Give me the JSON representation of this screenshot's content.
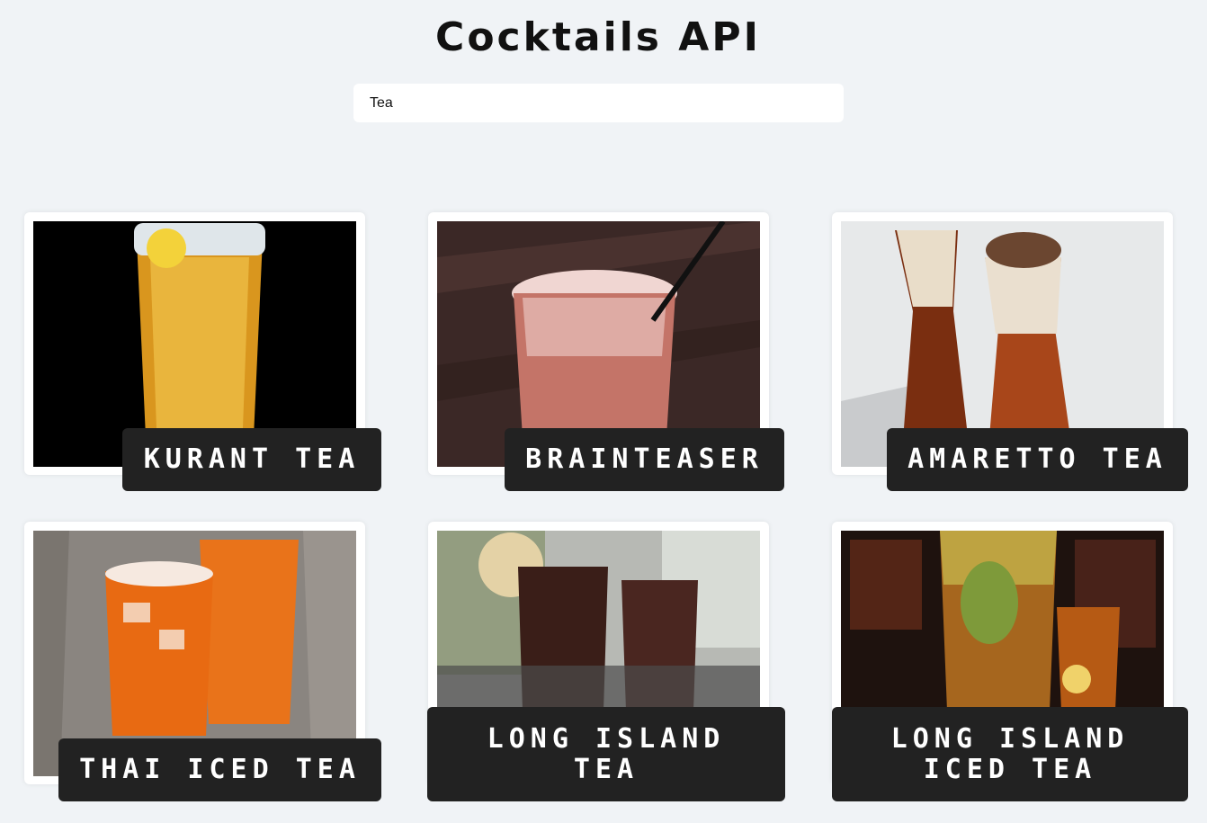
{
  "header": {
    "title": "Cocktails API"
  },
  "search": {
    "value": "Tea"
  },
  "cards": [
    {
      "name": "KURANT TEA"
    },
    {
      "name": "BRAINTEASER"
    },
    {
      "name": "AMARETTO TEA"
    },
    {
      "name": "THAI ICED TEA"
    },
    {
      "name": "LONG ISLAND TEA"
    },
    {
      "name": "LONG ISLAND ICED TEA"
    }
  ]
}
